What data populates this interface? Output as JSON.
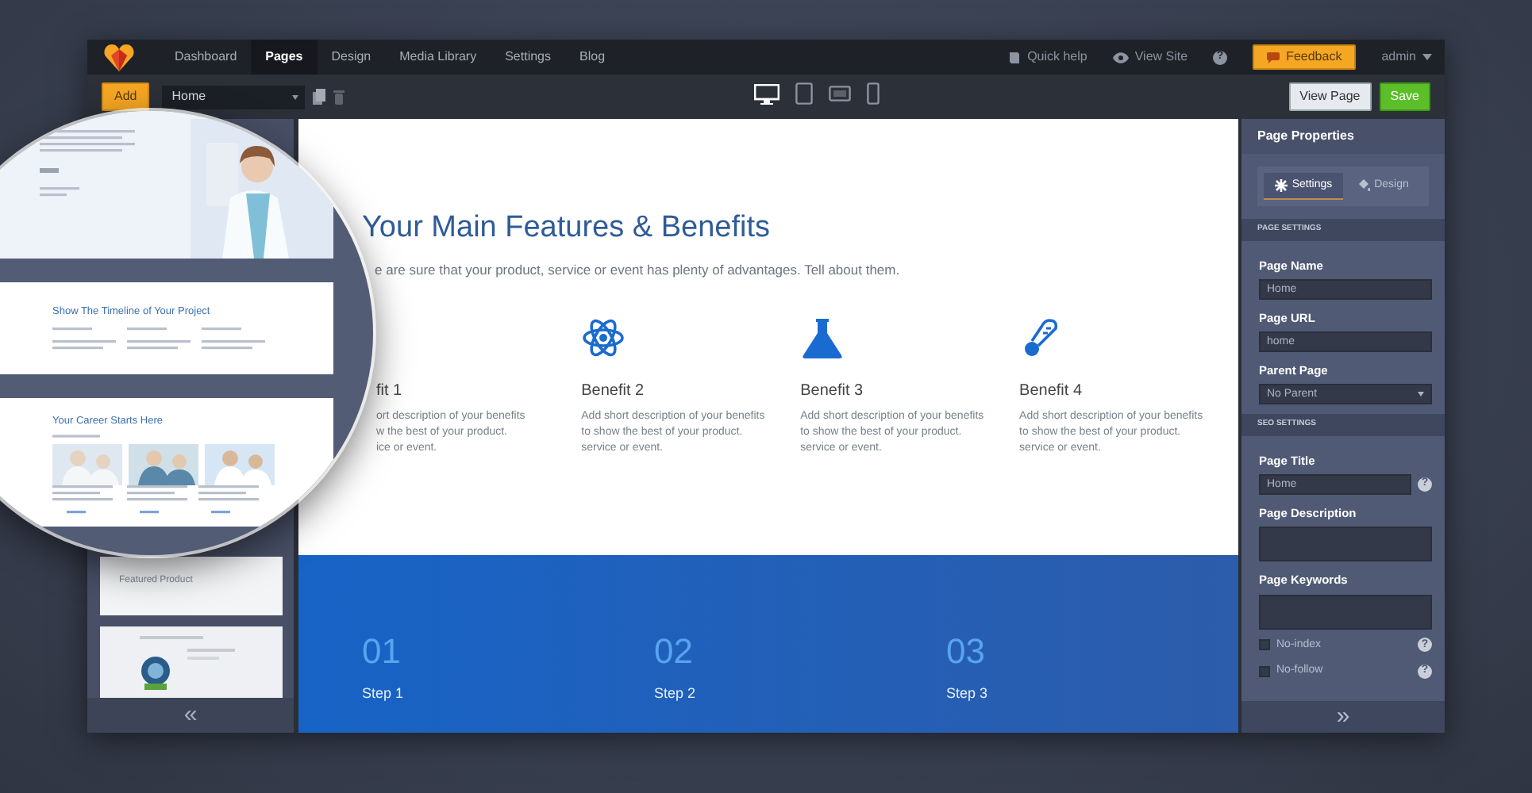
{
  "nav": {
    "items": [
      {
        "label": "Dashboard",
        "selected": false
      },
      {
        "label": "Pages",
        "selected": true
      },
      {
        "label": "Design",
        "selected": false
      },
      {
        "label": "Media Library",
        "selected": false
      },
      {
        "label": "Settings",
        "selected": false
      },
      {
        "label": "Blog",
        "selected": false
      }
    ],
    "quick_help": "Quick help",
    "view_site": "View Site",
    "help": "?",
    "feedback": "Feedback",
    "user": "admin"
  },
  "toolbar": {
    "add": "Add",
    "page_select": "Home",
    "devices": [
      {
        "kind": "desktop",
        "selected": true
      },
      {
        "kind": "tablet",
        "selected": false
      },
      {
        "kind": "landscape",
        "selected": false
      },
      {
        "kind": "phone",
        "selected": false
      }
    ],
    "view_page": "View Page",
    "save": "Save"
  },
  "sidebar": {
    "thumbnails": [
      {
        "kind": "text",
        "title": "Featured Product"
      },
      {
        "kind": "picture"
      }
    ],
    "collapse": "«"
  },
  "magnifier": {
    "sections": [
      {
        "kind": "hero"
      },
      {
        "kind": "timeline",
        "title": "Show The Timeline of Your Project"
      },
      {
        "kind": "career",
        "title": "Your Career Starts Here"
      }
    ]
  },
  "canvas": {
    "title": "Your Main Features & Benefits",
    "subtitle": "e are sure that your product, service or event has plenty of advantages. Tell about them.",
    "benefits": [
      {
        "title": "fit 1",
        "description": "ort description of your benefits\nw the best of your product.\nice or event."
      },
      {
        "title": "Benefit 2",
        "description": "Add short description of your benefits\nto show the best of your product.\nservice or event."
      },
      {
        "title": "Benefit 3",
        "description": "Add short description of your benefits\nto show the best of your product.\nservice or event."
      },
      {
        "title": "Benefit 4",
        "description": "Add short description of your benefits\nto show the best of your product.\nservice or event."
      }
    ],
    "steps": [
      {
        "number": "01",
        "label": "Step 1"
      },
      {
        "number": "02",
        "label": "Step 2"
      },
      {
        "number": "03",
        "label": "Step 3"
      }
    ]
  },
  "panel": {
    "title": "Page Properties",
    "tabs": [
      {
        "kind": "settings",
        "label": "Settings",
        "selected": true
      },
      {
        "kind": "design",
        "label": "Design",
        "selected": false
      }
    ],
    "sections": [
      {
        "heading": "PAGE SETTINGS",
        "fields": [
          {
            "kind": "text",
            "label": "Page Name",
            "value": "Home"
          },
          {
            "kind": "text",
            "label": "Page URL",
            "value": "home"
          },
          {
            "kind": "select",
            "label": "Parent Page",
            "value": "No Parent"
          }
        ]
      },
      {
        "heading": "SEO SETTINGS",
        "fields": [
          {
            "kind": "text",
            "label": "Page Title",
            "value": "Home",
            "help": "?"
          },
          {
            "kind": "textarea",
            "label": "Page Description"
          },
          {
            "kind": "textarea",
            "label": "Page Keywords"
          },
          {
            "kind": "checkbox",
            "label": "No-index",
            "checked": false,
            "help": "?"
          },
          {
            "kind": "checkbox",
            "label": "No-follow",
            "checked": false,
            "help": "?"
          }
        ]
      }
    ],
    "expand": "»"
  }
}
